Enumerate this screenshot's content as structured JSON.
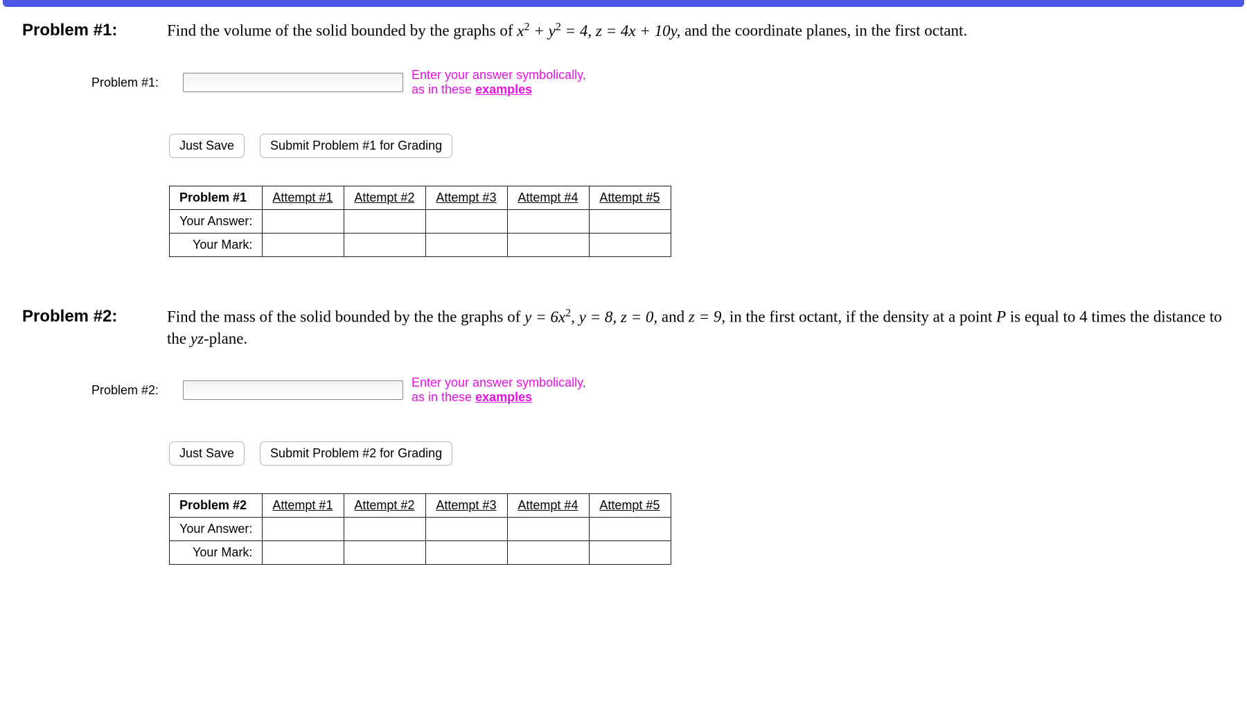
{
  "problems": [
    {
      "label": "Problem #1:",
      "text_pre": "Find the volume of the solid bounded by the graphs of ",
      "math1": "x² + y² = 4, z = 4x + 10y,",
      "text_post": " and the coordinate planes, in the first octant.",
      "answer_label": "Problem #1:",
      "hint_line1": "Enter your answer symbolically,",
      "hint_line2": "as in these ",
      "hint_link": "examples",
      "save_label": "Just Save",
      "submit_label": "Submit Problem #1 for Grading",
      "table_corner": "Problem #1",
      "row_answer": "Your Answer:",
      "row_mark": "Your Mark:",
      "attempts": [
        "Attempt #1",
        "Attempt #2",
        "Attempt #3",
        "Attempt #4",
        "Attempt #5"
      ]
    },
    {
      "label": "Problem #2:",
      "text_pre": "Find the mass of the solid bounded by the the graphs of ",
      "math1": "y = 6x², y = 8, z = 0,",
      "math2": " and ",
      "math3": "z = 9,",
      "text_post": " in the first octant, if the density at a point ",
      "math4": "P",
      "text_post2": " is equal to 4 times the distance to the ",
      "math5": "yz",
      "text_post3": "-plane.",
      "answer_label": "Problem #2:",
      "hint_line1": "Enter your answer symbolically,",
      "hint_line2": "as in these ",
      "hint_link": "examples",
      "save_label": "Just Save",
      "submit_label": "Submit Problem #2 for Grading",
      "table_corner": "Problem #2",
      "row_answer": "Your Answer:",
      "row_mark": "Your Mark:",
      "attempts": [
        "Attempt #1",
        "Attempt #2",
        "Attempt #3",
        "Attempt #4",
        "Attempt #5"
      ]
    }
  ]
}
